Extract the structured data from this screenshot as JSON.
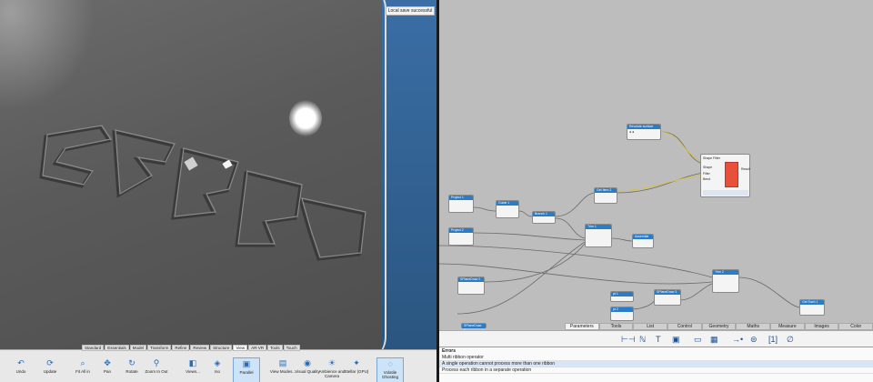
{
  "viewport": {
    "toast": "Local save successful"
  },
  "ribbon": {
    "tabs": [
      "Standard",
      "Essentials",
      "Model",
      "Transform",
      "Refine",
      "Review",
      "Structure",
      "View",
      "AR-VR",
      "Tools",
      "Touch"
    ],
    "active_tab": "View",
    "buttons": [
      {
        "label": "Undo",
        "icon": "undo-icon"
      },
      {
        "label": "Update",
        "icon": "update-icon"
      },
      {
        "label": "Fit All in",
        "icon": "fit-all-icon"
      },
      {
        "label": "Pan",
        "icon": "pan-icon"
      },
      {
        "label": "Rotate",
        "icon": "rotate-icon"
      },
      {
        "label": "Zoom In Out",
        "icon": "zoom-icon"
      },
      {
        "label": "Views...",
        "icon": "views-icon"
      },
      {
        "label": "Iso",
        "icon": "iso-icon"
      },
      {
        "label": "Parallel",
        "icon": "parallel-icon"
      },
      {
        "label": "View Modes...",
        "icon": "view-modes-icon"
      },
      {
        "label": "Visual Quality",
        "icon": "visual-quality-icon"
      },
      {
        "label": "Ambience and Camera",
        "icon": "ambience-icon"
      },
      {
        "label": "Stellar (GPU)",
        "icon": "stellar-icon"
      },
      {
        "label": "Volatile Ghosting",
        "icon": "ghosting-icon"
      }
    ]
  },
  "graph": {
    "nodes": [
      {
        "id": "n1",
        "title": "Revolute surface"
      },
      {
        "id": "n2",
        "title": "Shape Filter"
      },
      {
        "id": "n3",
        "title": "Get Item 2"
      },
      {
        "id": "n4",
        "title": "Project 1"
      },
      {
        "id": "n5",
        "title": "Guide 1"
      },
      {
        "id": "n6",
        "title": "Branch 1"
      },
      {
        "id": "n7",
        "title": "Project 2"
      },
      {
        "id": "n8",
        "title": "Trim 1"
      },
      {
        "id": "n9",
        "title": "Assemble 1"
      },
      {
        "id": "n10",
        "title": "SPlaneDraw 2"
      },
      {
        "id": "n11",
        "title": "Trim 2"
      },
      {
        "id": "n12",
        "title": "Get Each 1"
      },
      {
        "id": "n13",
        "title": "SPlaneDraw 3"
      },
      {
        "id": "n14",
        "title": "SPlaneDraw 1"
      },
      {
        "id": "n15",
        "title": "pt 1"
      },
      {
        "id": "n16",
        "title": "pt 2"
      }
    ],
    "shape_filter_labels": [
      "Shape",
      "Result",
      "Filter",
      "Bend"
    ]
  },
  "tabs": [
    "Parameters",
    "Tools",
    "List",
    "Control",
    "Geometry",
    "Maths",
    "Measure",
    "Images",
    "Color"
  ],
  "active_panel_tab": "Parameters",
  "errors": {
    "title": "Errors",
    "lines": [
      "Multi ribbon operator",
      "A single operation cannot process more than one ribbon",
      "Process each ribbon in a separate operation"
    ]
  },
  "colors": {
    "accent": "#2a7bc8",
    "filter_red": "#e8503a",
    "port_green": "#3ab54a"
  }
}
